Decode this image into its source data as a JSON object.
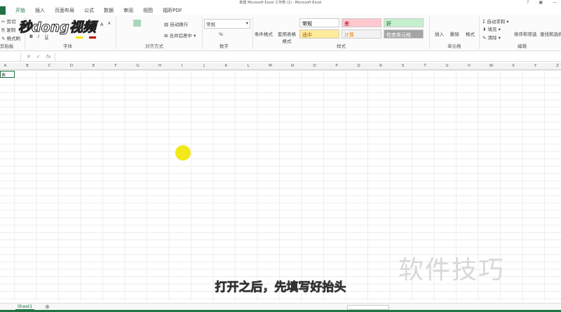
{
  "window": {
    "title": "新建 Microsoft Excel 工作表 (2) - Microsoft Excel",
    "controls": [
      "?",
      "▣",
      "—"
    ]
  },
  "tabs": [
    "开始",
    "插入",
    "页面布局",
    "公式",
    "数据",
    "审阅",
    "视图",
    "福昕PDF"
  ],
  "clipboard": {
    "cut": "剪切",
    "copy": "复制",
    "painter": "格式刷",
    "group": "剪贴板"
  },
  "font": {
    "bold": "B",
    "italic": "I",
    "underline": "U",
    "grow": "A",
    "shrink": "A",
    "group": "字体"
  },
  "alignment": {
    "wrap": "自动换行",
    "merge": "合并后居中",
    "group": "对齐方式"
  },
  "number": {
    "format": "常规",
    "percent": "%",
    "group": "数字"
  },
  "styles": {
    "conditional": "条件格式",
    "table": "套用表格格式",
    "cells": [
      {
        "label": "常规",
        "bg": "#ffffff",
        "fg": "#000"
      },
      {
        "label": "差",
        "bg": "#ffc7ce",
        "fg": "#9c0006"
      },
      {
        "label": "好",
        "bg": "#c6efce",
        "fg": "#006100"
      },
      {
        "label": "适中",
        "bg": "#ffeb9c",
        "fg": "#9c5700"
      },
      {
        "label": "计算",
        "bg": "#f2f2f2",
        "fg": "#fa7d00"
      },
      {
        "label": "检查单元格",
        "bg": "#a5a5a5",
        "fg": "#ffffff"
      }
    ],
    "group": "样式"
  },
  "cellsgrp": {
    "insert": "插入",
    "delete": "删除",
    "format": "格式",
    "group": "单元格"
  },
  "editing": {
    "autosum": "自动求和",
    "fill": "填充",
    "clear": "清除",
    "sort": "排序和筛选",
    "find": "查找和选择",
    "group": "编辑"
  },
  "formula_bar": {
    "fx": "fx",
    "value": ""
  },
  "columns": [
    "A",
    "B",
    "C",
    "D",
    "E",
    "F",
    "G",
    "H",
    "I",
    "J",
    "K",
    "L",
    "M",
    "N",
    "O",
    "P",
    "Q",
    "R",
    "S",
    "T",
    "U",
    "V",
    "W",
    "X",
    "Y",
    "Z"
  ],
  "cell_a1": "表",
  "sheets": [
    "Sheet1"
  ],
  "logo": "秒dong视频",
  "subtitle": "打开之后，先填写好抬头",
  "watermark": "软件技巧"
}
